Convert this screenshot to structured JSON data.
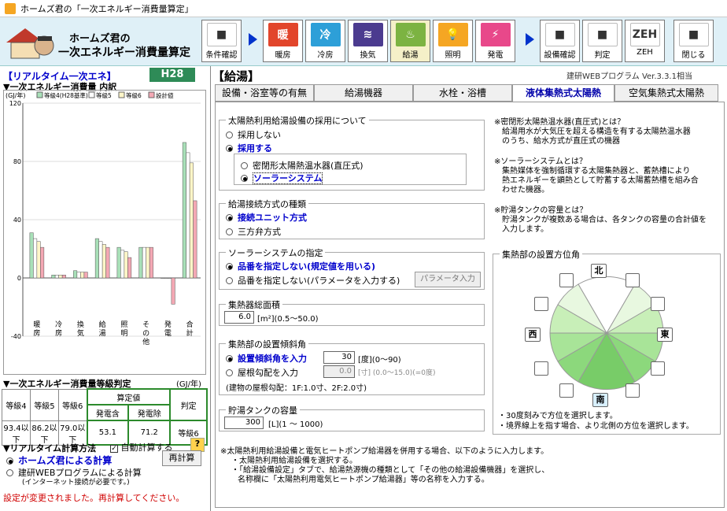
{
  "window": {
    "title": "ホームズ君の「一次エネルギー消費量算定」"
  },
  "logo": {
    "line1": "ホームズ君の",
    "line2": "一次エネルギー消費量算定"
  },
  "toolbar": {
    "buttons": [
      {
        "label": "条件確認",
        "icon": "house-icon",
        "color": "#ffffff"
      },
      {
        "label": "暖房",
        "icon": "heating-icon",
        "color": "#e2452b",
        "glyph": "暖"
      },
      {
        "label": "冷房",
        "icon": "cooling-icon",
        "color": "#2d9fd8",
        "glyph": "冷"
      },
      {
        "label": "換気",
        "icon": "ventilation-icon",
        "color": "#4b3b8f",
        "glyph": "≋"
      },
      {
        "label": "給湯",
        "icon": "hot-water-icon",
        "color": "#7cb342",
        "glyph": "♨"
      },
      {
        "label": "照明",
        "icon": "lighting-icon",
        "color": "#f5a623",
        "glyph": "💡"
      },
      {
        "label": "発電",
        "icon": "power-generation-icon",
        "color": "#e8488a",
        "glyph": "⚡"
      },
      {
        "label": "設備確認",
        "icon": "equipment-check-icon",
        "color": "#ffffff"
      },
      {
        "label": "判定",
        "icon": "judgement-icon",
        "color": "#ffffff"
      },
      {
        "label": "ZEH",
        "icon": "zeh-icon",
        "color": "#ffffff",
        "glyph": "ZEH"
      },
      {
        "label": "閉じる",
        "icon": "exit-icon",
        "color": "#ffffff"
      }
    ]
  },
  "left": {
    "realtime_title": "【リアルタイム一次エネ】",
    "badge": "H28",
    "breakdown_title": "▼一次エネルギー消費量 内訳",
    "chart_unit": "(GJ/年)",
    "grade_title": "▼一次エネルギー消費量等級判定",
    "grade_unit": "(GJ/年)",
    "grade_headers": [
      "等級4",
      "等級5",
      "等級6",
      "算定値",
      "判定"
    ],
    "sub_headers": [
      "発電含",
      "発電除"
    ],
    "grade_values": [
      "93.4以下",
      "86.2以下",
      "79.0以下",
      "53.1",
      "71.2",
      "等級6"
    ],
    "calc_title": "▼リアルタイム計算方法",
    "auto_calc": "自動計算する",
    "help": "?",
    "calc_opt1": "ホームズ君による計算",
    "calc_opt2": "建研WEBプログラムによる計算",
    "calc_opt2_note": "(インターネット接続が必要です。)",
    "recalc": "再計算",
    "status": "設定が変更されました。再計算してください。"
  },
  "chart_data": {
    "type": "bar",
    "ylim": [
      -40,
      120
    ],
    "yticks": [
      -40,
      0,
      40,
      80,
      120
    ],
    "categories": [
      "暖房",
      "冷房",
      "換気",
      "給湯",
      "照明",
      "その他",
      "発電",
      "合計"
    ],
    "series": [
      {
        "name": "等級4(H28基準)",
        "color": "#a8e0b8",
        "values": [
          31,
          2,
          5,
          27,
          21,
          21,
          0,
          93
        ]
      },
      {
        "name": "等級5",
        "color": "#ffffff",
        "values": [
          27,
          2,
          4,
          25,
          19,
          21,
          0,
          86
        ]
      },
      {
        "name": "等級6",
        "color": "#fff6c8",
        "values": [
          25,
          2,
          4,
          23,
          18,
          21,
          0,
          79
        ]
      },
      {
        "name": "設計値",
        "color": "#f4a8b4",
        "values": [
          21,
          2,
          4,
          21,
          14,
          21,
          -18,
          53
        ]
      }
    ]
  },
  "main": {
    "section_title": "【給湯】",
    "version": "建研WEBプログラム Ver.3.3.1相当",
    "tabs": [
      "設備・浴室等の有無",
      "給湯機器",
      "水栓・浴槽",
      "液体集熱式太陽熱",
      "空気集熱式太陽熱"
    ],
    "g1": {
      "title": "太陽熱利用給湯設備の採用について",
      "opt_no": "採用しない",
      "opt_yes": "採用する",
      "sub1": "密閉形太陽熱温水器(直圧式)",
      "sub2": "ソーラーシステム"
    },
    "g2": {
      "title": "給湯接続方式の種類",
      "opt1": "接続ユニット方式",
      "opt2": "三方弁方式"
    },
    "g3": {
      "title": "ソーラーシステムの指定",
      "opt1": "品番を指定しない(規定値を用いる)",
      "opt2": "品番を指定しない(パラメータを入力する)",
      "param_btn": "パラメータ入力"
    },
    "g4": {
      "title": "集熱器総面積",
      "value": "6.0",
      "unit": "[m²](0.5〜50.0)"
    },
    "g5": {
      "title": "集熱部の設置傾斜角",
      "opt1": "設置傾斜角を入力",
      "value1": "30",
      "unit1": "[度](0〜90)",
      "opt2": "屋根勾配を入力",
      "value2": "0.0",
      "unit2": "[寸]  (0.0〜15.0)(=0度)",
      "note": "(建物の屋根勾配：1F:1.0寸、2F:2.0寸)"
    },
    "g6": {
      "title": "貯湯タンクの容量",
      "value": "300",
      "unit": "[L](1 〜 1000)"
    },
    "notes": [
      "※密閉形太陽熱温水器(直圧式)とは？",
      "給湯用水が大気圧を超える構造を有する太陽熱温水器",
      "のうち、給水方式が直圧式の機器",
      "※ソーラーシステムとは？",
      "集熱媒体を強制循環する太陽集熱器と、蓄熱槽により",
      "熱エネルギーを顕熱として貯蓄する太陽蓄熱槽を組み合",
      "わせた機器。",
      "※貯湯タンクの容量とは？",
      "貯湯タンクが複数ある場合は、各タンクの容量の合計値を",
      "入力します。"
    ],
    "compass": {
      "title": "集熱部の設置方位角",
      "north": "北",
      "south": "南",
      "east": "東",
      "west": "西",
      "note1": "・30度刻みで方位を選択します。",
      "note2": "・境界線上を指す場合、より北側の方位を選択します。"
    },
    "footer": [
      "※太陽熱利用給湯設備と電気ヒートポンプ給湯器を併用する場合、以下のように入力します。",
      "・太陽熱利用給湯設備を選択する。",
      "・「給湯設備設定」タブで、給湯熱源機の種類として「その他の給湯設備機器」を選択し、",
      "名称欄に「太陽熱利用電気ヒートポンプ給湯器」等の名称を入力する。"
    ]
  }
}
